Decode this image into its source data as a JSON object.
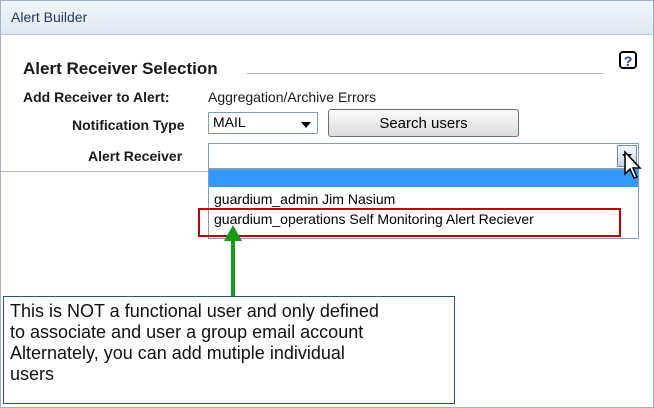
{
  "window": {
    "title": "Alert Builder"
  },
  "section": {
    "title": "Alert Receiver Selection",
    "help_symbol": "?"
  },
  "form": {
    "add_receiver_label": "Add Receiver to Alert:",
    "add_receiver_value": "Aggregation/Archive Errors",
    "notification_type_label": "Notification Type",
    "notification_type_value": "MAIL",
    "search_users_button": "Search users",
    "alert_receiver_label": "Alert Receiver",
    "alert_receiver_value": ""
  },
  "dropdown": {
    "options": [
      "",
      "guardium_admin Jim Nasium",
      "guardium_operations Self Monitoring Alert Reciever"
    ]
  },
  "annotation": {
    "lines": [
      "This is NOT a functional user and only defined",
      "to associate and user a group email account",
      "Alternately, you can add mutiple individual",
      "users"
    ]
  },
  "colors": {
    "highlight_box": "#c00000",
    "arrow": "#1a9a1a",
    "selection": "#3399ff",
    "note_border": "#2a4f8f"
  },
  "icons": {
    "help": "help-icon",
    "dropdown": "chevron-down-icon",
    "cursor": "mouse-pointer-icon",
    "callout_arrow": "arrow-up-icon"
  }
}
